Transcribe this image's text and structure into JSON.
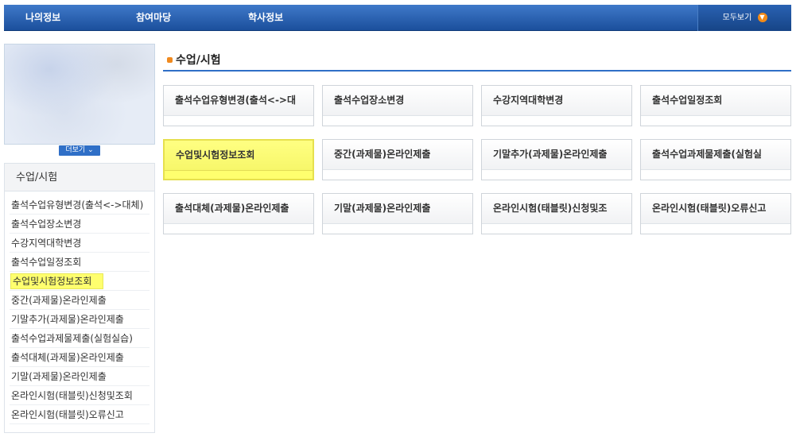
{
  "topnav": {
    "items": [
      "나의정보",
      "참여마당",
      "학사정보"
    ],
    "view_all": "모두보기"
  },
  "left": {
    "more_label": "더보기",
    "menu_title": "수업/시험",
    "items": [
      "출석수업유형변경(출석<->대체)",
      "출석수업장소변경",
      "수강지역대학변경",
      "출석수업일정조회",
      "수업및시험정보조회",
      "중간(과제물)온라인제출",
      "기말추가(과제물)온라인제출",
      "출석수업과제물제출(실험실습)",
      "출석대체(과제물)온라인제출",
      "기말(과제물)온라인제출",
      "온라인시험(태블릿)신청및조회",
      "온라인시험(태블릿)오류신고"
    ],
    "highlighted_index": 4
  },
  "content": {
    "title": "수업/시험",
    "tiles": [
      "출석수업유형변경(출석<->대",
      "출석수업장소변경",
      "수강지역대학변경",
      "출석수업일정조회",
      "수업및시험정보조회",
      "중간(과제물)온라인제출",
      "기말추가(과제물)온라인제출",
      "출석수업과제물제출(실험실",
      "출석대체(과제물)온라인제출",
      "기말(과제물)온라인제출",
      "온라인시험(태블릿)신청및조",
      "온라인시험(태블릿)오류신고"
    ],
    "highlighted_index": 4
  },
  "colors": {
    "nav": "#1b4f9c",
    "accent": "#2f6fc7",
    "highlight": "#ffff6e",
    "bullet": "#f08a1f"
  },
  "icons": {
    "viewall": "chevron-down-circle-icon",
    "more": "chevron-down-icon",
    "title_bullet": "square-bullet-icon"
  }
}
